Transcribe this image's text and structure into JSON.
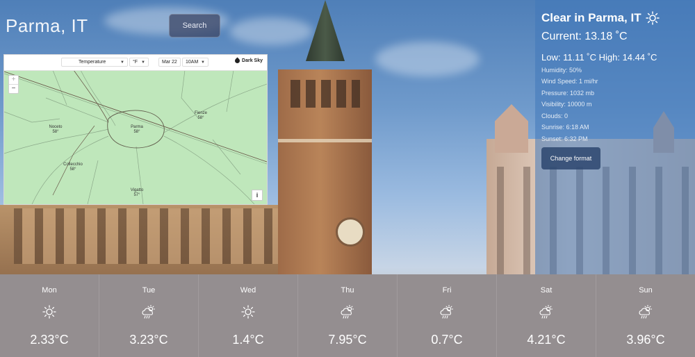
{
  "header": {
    "city": "Parma, IT",
    "search_label": "Search"
  },
  "map": {
    "layer_select": "Temperature",
    "unit_select": "°F",
    "date_select": "Mar 22",
    "time_select": "10AM",
    "brand": "Dark Sky",
    "zoom_in": "+",
    "zoom_out": "−",
    "info": "i",
    "labels": [
      {
        "name": "Noceto",
        "temp": "58°"
      },
      {
        "name": "Parma",
        "temp": "58°"
      },
      {
        "name": "Fienze",
        "temp": "58°"
      },
      {
        "name": "Collecchio",
        "temp": "58°"
      },
      {
        "name": "Vigatto",
        "temp": "57°"
      }
    ]
  },
  "panel": {
    "title": "Clear in Parma, IT",
    "current": "Current: 13.18 ˚C",
    "lowhigh": "Low: 11.11 ˚C High: 14.44 ˚C",
    "humidity": "Humidity: 50%",
    "wind": "Wind Speed: 1 mi/hr",
    "pressure": "Pressure: 1032 mb",
    "visibility": "Visibility: 10000 m",
    "clouds": "Clouds: 0",
    "sunrise": "Sunrise: 6:18 AM",
    "sunset": "Sunset: 6:32 PM",
    "format_button": "Change format"
  },
  "forecast": [
    {
      "day": "Mon",
      "icon": "sun-icon",
      "temp": "2.33°C"
    },
    {
      "day": "Tue",
      "icon": "cloud-rain-sun-icon",
      "temp": "3.23°C"
    },
    {
      "day": "Wed",
      "icon": "sun-icon",
      "temp": "1.4°C"
    },
    {
      "day": "Thu",
      "icon": "cloud-rain-sun-icon",
      "temp": "7.95°C"
    },
    {
      "day": "Fri",
      "icon": "cloud-rain-sun-icon",
      "temp": "0.7°C"
    },
    {
      "day": "Sat",
      "icon": "cloud-rain-sun-icon",
      "temp": "4.21°C"
    },
    {
      "day": "Sun",
      "icon": "cloud-rain-sun-icon",
      "temp": "3.96°C"
    }
  ]
}
